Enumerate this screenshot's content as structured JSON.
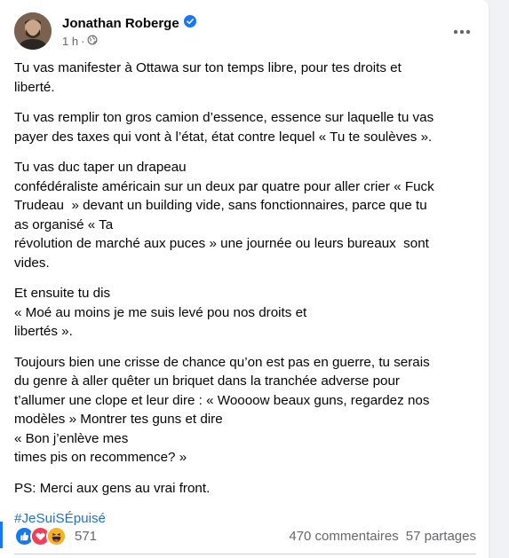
{
  "post": {
    "author": "Jonathan Roberge",
    "timestamp": "1 h",
    "separator": "·",
    "paragraphs": [
      [
        "Tu vas manifester à Ottawa sur ton temps libre, pour tes droits et",
        "liberté."
      ],
      [
        "Tu vas remplir ton gros camion d’essence, essence sur laquelle tu vas",
        "payer des taxes qui vont à l’état, état contre lequel « Tu te soulèves »."
      ],
      [
        "Tu vas duc taper un drapeau",
        "confédéraliste américain sur un deux par quatre pour aller crier « Fuck",
        "Trudeau  » devant un building vide, sans fonctionnaires, parce que tu",
        "as organisé « Ta",
        "révolution de marché aux puces » une journée ou leurs bureaux  sont",
        "vides."
      ],
      [
        "Et ensuite tu dis",
        "« Moé au moins je me suis levé pou nos droits et",
        "libertés »."
      ],
      [
        "Toujours bien une crisse de chance qu’on est pas en guerre, tu serais",
        "du genre à aller quêter un briquet dans la tranchée adverse pour",
        "t’allumer une clope et leur dire : « Woooow beaux guns, regardez nos",
        "modèles » Montrer tes guns et dire",
        "« Bon j’enlève mes",
        "times pis on recommence? »"
      ],
      [
        "PS: Merci aux gens au vrai front."
      ]
    ],
    "hashtag": "#JeSuiSÉpuisé"
  },
  "footer": {
    "reaction_count": "571",
    "comments": "470 commentaires",
    "shares": "57 partages"
  },
  "colors": {
    "link": "#216fdb",
    "verified": "#1877f2",
    "meta": "#65676b"
  },
  "icons": {
    "verified": "verified-badge-icon",
    "audience": "globe-icon",
    "more": "more-options-icon",
    "reactions": [
      "like-icon",
      "love-icon",
      "haha-icon"
    ]
  }
}
